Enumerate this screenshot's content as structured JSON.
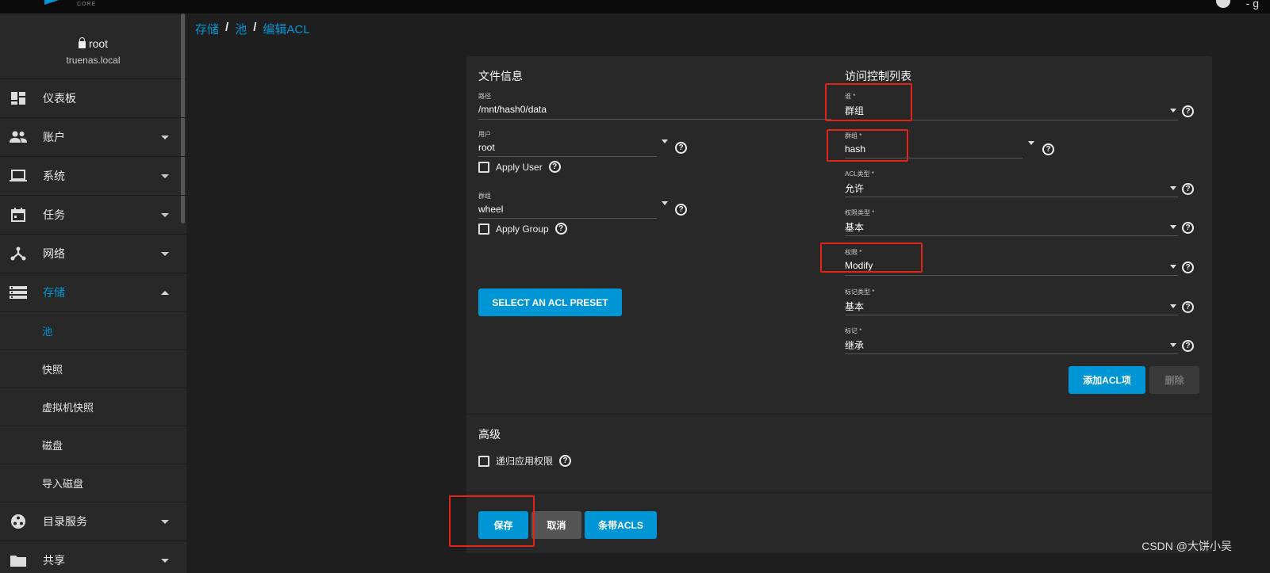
{
  "topbar": {
    "logo_sub": "CORE",
    "right_text": "- g"
  },
  "sidebar": {
    "user": "root",
    "host": "truenas.local",
    "items": [
      {
        "label": "仪表板",
        "icon": "dashboard-icon"
      },
      {
        "label": "账户",
        "icon": "people-icon"
      },
      {
        "label": "系统",
        "icon": "laptop-icon"
      },
      {
        "label": "任务",
        "icon": "calendar-icon"
      },
      {
        "label": "网络",
        "icon": "network-icon"
      },
      {
        "label": "存储",
        "icon": "storage-icon"
      },
      {
        "label": "目录服务",
        "icon": "directory-icon"
      },
      {
        "label": "共享",
        "icon": "folder-share-icon"
      }
    ],
    "storage_sub": [
      "池",
      "快照",
      "虚拟机快照",
      "磁盘",
      "导入磁盘"
    ]
  },
  "breadcrumb": {
    "storage": "存储",
    "pool": "池",
    "current": "编辑ACL",
    "sep": "/"
  },
  "file_info": {
    "title": "文件信息",
    "path_label": "路径",
    "path_value": "/mnt/hash0/data",
    "user_label": "用户",
    "user_value": "root",
    "apply_user": "Apply User",
    "group_label": "群组",
    "group_value": "wheel",
    "apply_group": "Apply Group",
    "preset_button": "SELECT AN ACL PRESET"
  },
  "acl": {
    "title": "访问控制列表",
    "who_label": "谁 *",
    "who_value": "群组",
    "group_label": "群组 *",
    "group_value": "hash",
    "acl_type_label": "ACL类型 *",
    "acl_type_value": "允许",
    "perm_type_label": "权限类型 *",
    "perm_type_value": "基本",
    "perm_label": "权限 *",
    "perm_value": "Modify",
    "flag_type_label": "标记类型 *",
    "flag_type_value": "基本",
    "flag_label": "标记 *",
    "flag_value": "继承",
    "add_button": "添加ACL项",
    "delete_button": "删除"
  },
  "advanced": {
    "title": "高级",
    "recursive_label": "递归应用权限"
  },
  "actions": {
    "save": "保存",
    "cancel": "取消",
    "strip": "条带ACLS"
  },
  "watermark": "CSDN @大饼小吴",
  "colors": {
    "accent": "#0095d5",
    "highlight": "#e0241b",
    "background": "#1e1e1e",
    "panel": "#282828"
  }
}
